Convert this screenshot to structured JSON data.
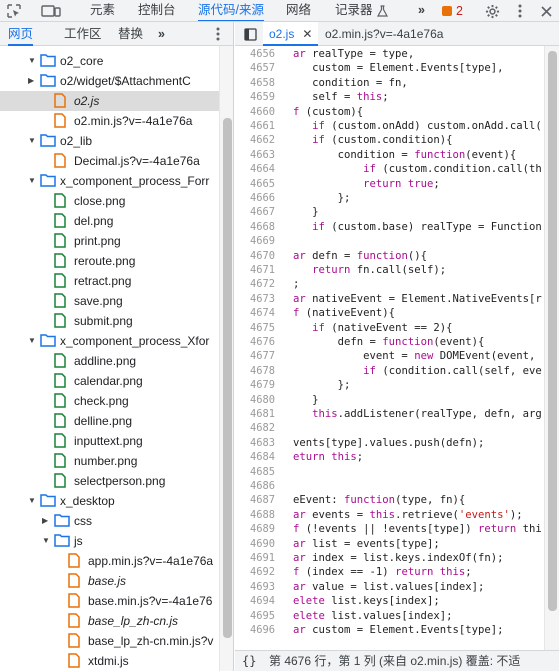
{
  "toolbar": {
    "tabs": [
      {
        "label": "元素",
        "active": false
      },
      {
        "label": "控制台",
        "active": false
      },
      {
        "label": "源代码/来源",
        "active": true
      },
      {
        "label": "网络",
        "active": false
      },
      {
        "label": "记录器",
        "active": false
      }
    ],
    "more": "»",
    "issues_count": "2"
  },
  "nav_tabs": [
    {
      "label": "网页",
      "active": true
    },
    {
      "label": "工作区",
      "active": false
    },
    {
      "label": "替换",
      "active": false
    }
  ],
  "nav_more": "»",
  "tree": [
    {
      "label": "o2_core",
      "type": "folder",
      "open": true
    },
    {
      "label": "o2/widget/$AttachmentC",
      "type": "folder",
      "open": false
    },
    {
      "label": "o2.js",
      "type": "js",
      "italic": true,
      "selected": true
    },
    {
      "label": "o2.min.js?v=-4a1e76a",
      "type": "js"
    },
    {
      "label": "o2_lib",
      "type": "folder",
      "open": true
    },
    {
      "label": "Decimal.js?v=-4a1e76a",
      "type": "js"
    },
    {
      "label": "x_component_process_Forr",
      "type": "folder",
      "open": true
    },
    {
      "label": "close.png",
      "type": "img"
    },
    {
      "label": "del.png",
      "type": "img"
    },
    {
      "label": "print.png",
      "type": "img"
    },
    {
      "label": "reroute.png",
      "type": "img"
    },
    {
      "label": "retract.png",
      "type": "img"
    },
    {
      "label": "save.png",
      "type": "img"
    },
    {
      "label": "submit.png",
      "type": "img"
    },
    {
      "label": "x_component_process_Xfor",
      "type": "folder",
      "open": true
    },
    {
      "label": "addline.png",
      "type": "img"
    },
    {
      "label": "calendar.png",
      "type": "img"
    },
    {
      "label": "check.png",
      "type": "img"
    },
    {
      "label": "delline.png",
      "type": "img"
    },
    {
      "label": "inputtext.png",
      "type": "img"
    },
    {
      "label": "number.png",
      "type": "img"
    },
    {
      "label": "selectperson.png",
      "type": "img"
    },
    {
      "label": "x_desktop",
      "type": "folder",
      "open": true
    },
    {
      "label": "css",
      "type": "folder",
      "open": false
    },
    {
      "label": "js",
      "type": "folder",
      "open": true
    },
    {
      "label": "app.min.js?v=-4a1e76a",
      "type": "js"
    },
    {
      "label": "base.js",
      "type": "js",
      "italic": true
    },
    {
      "label": "base.min.js?v=-4a1e76",
      "type": "js"
    },
    {
      "label": "base_lp_zh-cn.js",
      "type": "js",
      "italic": true
    },
    {
      "label": "base_lp_zh-cn.min.js?v",
      "type": "js"
    },
    {
      "label": "xtdmi.js",
      "type": "js"
    }
  ],
  "file_tabs": [
    {
      "label": "o2.js",
      "active": true,
      "closable": true
    },
    {
      "label": "o2.min.js?v=-4a1e76a",
      "active": false,
      "closable": false
    }
  ],
  "code": [
    {
      "n": "4656",
      "t": "ar realType = type,"
    },
    {
      "n": "4657",
      "t": "   custom = Element.Events[type],"
    },
    {
      "n": "4658",
      "t": "   condition = fn,"
    },
    {
      "n": "4659",
      "t": "   self = this;"
    },
    {
      "n": "4660",
      "t": "f (custom){"
    },
    {
      "n": "4661",
      "t": "   if (custom.onAdd) custom.onAdd.call("
    },
    {
      "n": "4662",
      "t": "   if (custom.condition){"
    },
    {
      "n": "4663",
      "t": "       condition = function(event){"
    },
    {
      "n": "4664",
      "t": "           if (custom.condition.call(th"
    },
    {
      "n": "4665",
      "t": "           return true;"
    },
    {
      "n": "4666",
      "t": "       };"
    },
    {
      "n": "4667",
      "t": "   }"
    },
    {
      "n": "4668",
      "t": "   if (custom.base) realType = Function"
    },
    {
      "n": "4669",
      "t": ""
    },
    {
      "n": "4670",
      "t": "ar defn = function(){"
    },
    {
      "n": "4671",
      "t": "   return fn.call(self);"
    },
    {
      "n": "4672",
      "t": ";"
    },
    {
      "n": "4673",
      "t": "ar nativeEvent = Element.NativeEvents[r"
    },
    {
      "n": "4674",
      "t": "f (nativeEvent){"
    },
    {
      "n": "4675",
      "t": "   if (nativeEvent == 2){"
    },
    {
      "n": "4676",
      "t": "       defn = function(event){"
    },
    {
      "n": "4677",
      "t": "           event = new DOMEvent(event,"
    },
    {
      "n": "4678",
      "t": "           if (condition.call(self, eve"
    },
    {
      "n": "4679",
      "t": "       };"
    },
    {
      "n": "4680",
      "t": "   }"
    },
    {
      "n": "4681",
      "t": "   this.addListener(realType, defn, arg"
    },
    {
      "n": "4682",
      "t": ""
    },
    {
      "n": "4683",
      "t": "vents[type].values.push(defn);"
    },
    {
      "n": "4684",
      "t": "eturn this;"
    },
    {
      "n": "4685",
      "t": ""
    },
    {
      "n": "4686",
      "t": ""
    },
    {
      "n": "4687",
      "t": "eEvent: function(type, fn){"
    },
    {
      "n": "4688",
      "t": "ar events = this.retrieve('events');"
    },
    {
      "n": "4689",
      "t": "f (!events || !events[type]) return thi"
    },
    {
      "n": "4690",
      "t": "ar list = events[type];"
    },
    {
      "n": "4691",
      "t": "ar index = list.keys.indexOf(fn);"
    },
    {
      "n": "4692",
      "t": "f (index == -1) return this;"
    },
    {
      "n": "4693",
      "t": "ar value = list.values[index];"
    },
    {
      "n": "4694",
      "t": "elete list.keys[index];"
    },
    {
      "n": "4695",
      "t": "elete list.values[index];"
    },
    {
      "n": "4696",
      "t": "ar custom = Element.Events[type];"
    }
  ],
  "status": {
    "braces": "{}",
    "text": "第 4676 行，第 1 列  (来自 o2.min.js) 覆盖: 不适"
  },
  "colors": {
    "accent": "#1a73e8",
    "folder": "#1a73e8",
    "js_file": "#e8710a",
    "img_file": "#188038",
    "keyword": "#aa0d91",
    "string": "#c41a16"
  }
}
